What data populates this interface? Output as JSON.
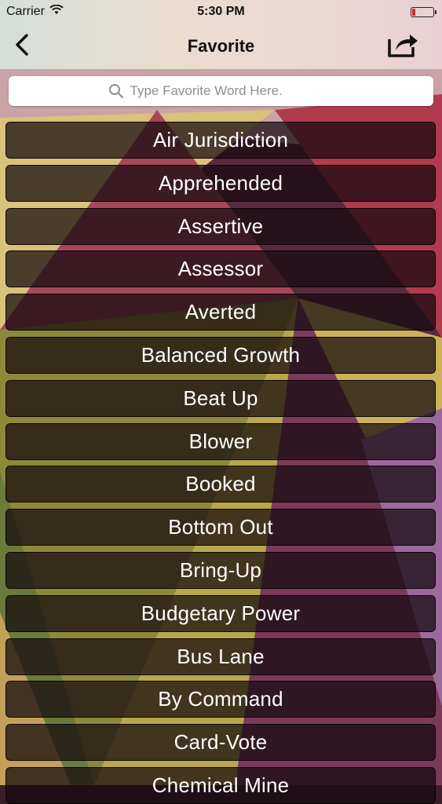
{
  "status_bar": {
    "carrier": "Carrier",
    "time": "5:30 PM"
  },
  "nav": {
    "title": "Favorite",
    "back_icon": "chevron-left-icon",
    "share_icon": "share-icon"
  },
  "search": {
    "placeholder": "Type Favorite Word Here.",
    "value": "",
    "icon": "search-icon"
  },
  "words": [
    "Air Jurisdiction",
    "Apprehended",
    "Assertive",
    "Assessor",
    "Averted",
    "Balanced Growth",
    "Beat Up",
    "Blower",
    "Booked",
    "Bottom Out",
    "Bring-Up",
    "Budgetary Power",
    "Bus Lane",
    "By Command",
    "Card-Vote",
    "Chemical Mine"
  ],
  "colors": {
    "battery_low": "#e0262b",
    "list_item_text": "#ffffff"
  }
}
